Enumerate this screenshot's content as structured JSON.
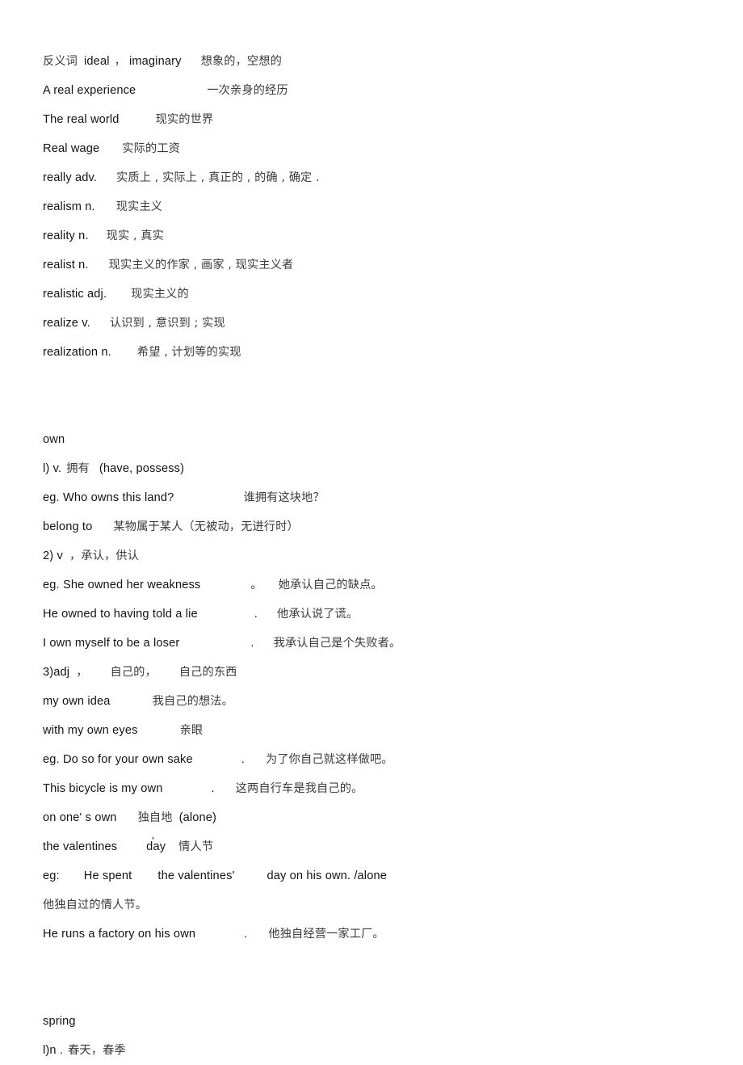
{
  "document": {
    "type": "vocabulary-study-notes",
    "sections": [
      {
        "id": "real",
        "heading": null,
        "lines": [
          {
            "id": "l1",
            "cn_lead": "反义词",
            "en": "ideal",
            "cn_mid": "，",
            "en2": "imaginary",
            "cn": "想象的，空想的"
          },
          {
            "id": "l2",
            "en": "A real experience",
            "cn": "一次亲身的经历"
          },
          {
            "id": "l3",
            "en": "The real world",
            "cn": "现实的世界"
          },
          {
            "id": "l4",
            "en": "Real wage",
            "cn": "实际的工资"
          },
          {
            "id": "l5",
            "en": "really adv.",
            "cn": "实质上 , 实际上 , 真正的 , 的确 , 确定 ."
          },
          {
            "id": "l6",
            "en": "realism n.",
            "cn": "现实主义"
          },
          {
            "id": "l7",
            "en": "reality n.",
            "cn": "现实 , 真实"
          },
          {
            "id": "l8",
            "en": "realist n.",
            "cn": "现实主义的作家 , 画家 , 现实主义者"
          },
          {
            "id": "l9",
            "en": "realistic adj.",
            "cn": "现实主义的"
          },
          {
            "id": "l10",
            "en": "realize v.",
            "cn": "认识到 , 意识到 ; 实现"
          },
          {
            "id": "l11",
            "en": "realization n.",
            "cn": "希望 , 计划等的实现"
          }
        ]
      },
      {
        "id": "own",
        "heading": "own",
        "lines": [
          {
            "id": "o1",
            "en": "l) v.",
            "cn": "拥有",
            "en_tail": "(have, possess)"
          },
          {
            "id": "o2",
            "en": "eg. Who owns this land?",
            "cn": "谁拥有这块地？"
          },
          {
            "id": "o3",
            "en": "belong to",
            "cn": "某物属于某人（无被动，无进行时）"
          },
          {
            "id": "o4",
            "en": "2) v",
            "cn": "，承认，供认"
          },
          {
            "id": "o5",
            "en": "eg. She owned her weakness",
            "punct": "。",
            "cn": "她承认自己的缺点。"
          },
          {
            "id": "o6",
            "en": "He owned to having told a lie",
            "punct": ".",
            "cn": "他承认说了谎。"
          },
          {
            "id": "o7",
            "en": "I own myself to be a loser",
            "punct": ".",
            "cn": "我承认自己是个失败者。"
          },
          {
            "id": "o8",
            "en": "3)adj",
            "cn": "，      自己的，      自己的东西"
          },
          {
            "id": "o9",
            "en": "my own idea",
            "cn": "我自己的想法。"
          },
          {
            "id": "o10",
            "en": "with my own eyes",
            "cn": "亲眼"
          },
          {
            "id": "o11",
            "en": "eg. Do so for your own sake",
            "punct": ".",
            "cn": "为了你自己就这样做吧。"
          },
          {
            "id": "o12",
            "en": "This bicycle is my own",
            "punct": ".",
            "cn": "这两自行车是我自己的。"
          },
          {
            "id": "o13",
            "en": "on one' s own",
            "cn": "独自地",
            "en_tail": "(alone)"
          },
          {
            "id": "o14",
            "en": "the valentines",
            "en_tick": "day",
            "cn": "情人节"
          },
          {
            "id": "o15",
            "en_parts": [
              "eg:",
              "He spent",
              "the valentines'",
              "day on his own. /alone"
            ]
          },
          {
            "id": "o16",
            "cn": "他独自过的情人节。"
          },
          {
            "id": "o17",
            "en": "He runs a factory on his own",
            "punct": ".",
            "cn": "他独自经营一家工厂。"
          }
        ]
      },
      {
        "id": "spring",
        "heading": "spring",
        "lines": [
          {
            "id": "s1",
            "en": "l)n .",
            "cn": "春天，春季"
          }
        ]
      }
    ]
  }
}
